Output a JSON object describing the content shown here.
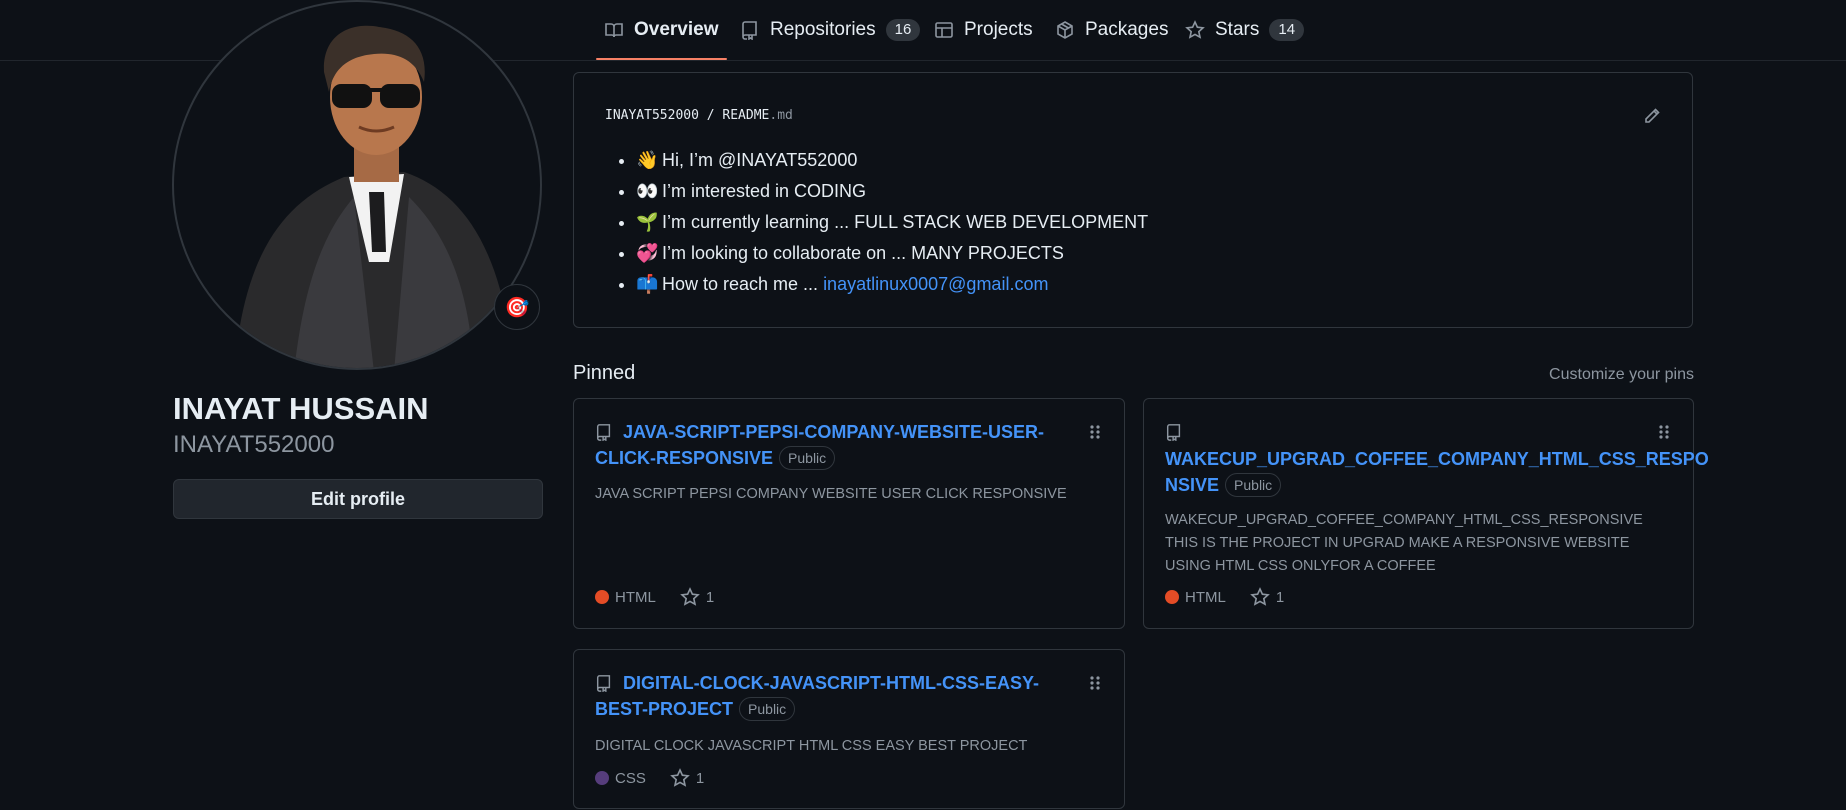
{
  "nav": {
    "tabs": [
      {
        "label": "Overview"
      },
      {
        "label": "Repositories",
        "count": "16"
      },
      {
        "label": "Projects"
      },
      {
        "label": "Packages"
      },
      {
        "label": "Stars",
        "count": "14"
      }
    ],
    "active_accent": "#f78166"
  },
  "profile": {
    "full_name": "INAYAT HUSSAIN",
    "username": "INAYAT552000",
    "edit_label": "Edit profile",
    "status_emoji": "🎯"
  },
  "readme": {
    "owner": "INAYAT552000",
    "separator": "/",
    "file": "README",
    "ext": ".md",
    "items": [
      {
        "emoji": "👋",
        "text": "Hi, I’m @INAYAT552000"
      },
      {
        "emoji": "👀",
        "text": "I’m interested in CODING"
      },
      {
        "emoji": "🌱",
        "text": "I’m currently learning ... FULL STACK WEB DEVELOPMENT"
      },
      {
        "emoji": "💞️",
        "text": "I’m looking to collaborate on ... MANY PROJECTS"
      },
      {
        "emoji": "📫",
        "text": "How to reach me ... ",
        "link": "inayatlinux0007@gmail.com"
      }
    ]
  },
  "pinned": {
    "title": "Pinned",
    "customize": "Customize your pins",
    "repos": [
      {
        "name": "JAVA-SCRIPT-PEPSI-COMPANY-WEBSITE-USER-CLICK-RESPONSIVE",
        "visibility": "Public",
        "description": "JAVA SCRIPT PEPSI COMPANY WEBSITE USER CLICK RESPONSIVE",
        "language": "HTML",
        "language_color": "#e34c26",
        "stars": "1"
      },
      {
        "name": "WAKECUP_UPGRAD_COFFEE_COMPANY_HTML_CSS_RESPONSIVE",
        "name_line1": "WAKECUP_UPGRAD_COFFEE_COMPANY_HTML_CSS_RESPO",
        "name_line2": "NSIVE",
        "visibility": "Public",
        "description": "WAKECUP_UPGRAD_COFFEE_COMPANY_HTML_CSS_RESPONSIVE THIS IS THE PROJECT IN UPGRAD MAKE A RESPONSIVE WEBSITE USING HTML CSS ONLYFOR A COFFEE",
        "language": "HTML",
        "language_color": "#e34c26",
        "stars": "1"
      },
      {
        "name": "DIGITAL-CLOCK-JAVASCRIPT-HTML-CSS-EASY-BEST-PROJECT",
        "visibility": "Public",
        "description": "DIGITAL CLOCK JAVASCRIPT HTML CSS EASY BEST PROJECT",
        "language": "CSS",
        "language_color": "#563d7c",
        "stars": "1"
      }
    ]
  }
}
